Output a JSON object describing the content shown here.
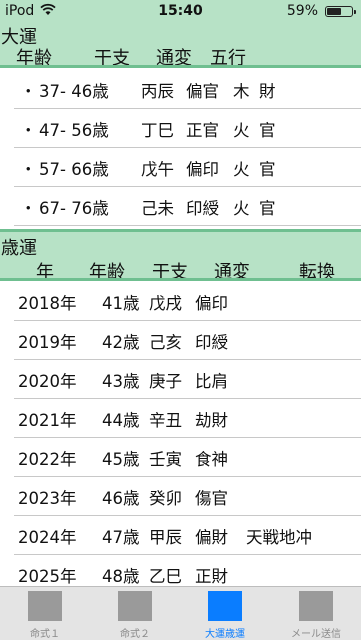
{
  "status_bar": {
    "carrier": "iPod",
    "time": "15:40",
    "battery": "59%",
    "battery_level": 0.59
  },
  "taiun": {
    "title": "大運",
    "headers": [
      "年齢",
      "干支",
      "通変",
      "五行"
    ],
    "rows": [
      {
        "bullet": "・",
        "age": "37- 46歳",
        "kanshi": "丙辰",
        "tsuhen": "偏官",
        "gogyo": "木",
        "kind": "財"
      },
      {
        "bullet": "・",
        "age": "47- 56歳",
        "kanshi": "丁巳",
        "tsuhen": "正官",
        "gogyo": "火",
        "kind": "官"
      },
      {
        "bullet": "・",
        "age": "57- 66歳",
        "kanshi": "戊午",
        "tsuhen": "偏印",
        "gogyo": "火",
        "kind": "官"
      },
      {
        "bullet": "・",
        "age": "67- 76歳",
        "kanshi": "己未",
        "tsuhen": "印綬",
        "gogyo": "火",
        "kind": "官"
      }
    ]
  },
  "saiun": {
    "title": "歳運",
    "headers": [
      "年",
      "年齢",
      "干支",
      "通変",
      "転換"
    ],
    "rows": [
      {
        "year": "2018年",
        "age": "41歳",
        "kanshi": "戊戌",
        "tsuhen": "偏印",
        "tenkan": ""
      },
      {
        "year": "2019年",
        "age": "42歳",
        "kanshi": "己亥",
        "tsuhen": "印綬",
        "tenkan": ""
      },
      {
        "year": "2020年",
        "age": "43歳",
        "kanshi": "庚子",
        "tsuhen": "比肩",
        "tenkan": ""
      },
      {
        "year": "2021年",
        "age": "44歳",
        "kanshi": "辛丑",
        "tsuhen": "劫財",
        "tenkan": ""
      },
      {
        "year": "2022年",
        "age": "45歳",
        "kanshi": "壬寅",
        "tsuhen": "食神",
        "tenkan": ""
      },
      {
        "year": "2023年",
        "age": "46歳",
        "kanshi": "癸卯",
        "tsuhen": "傷官",
        "tenkan": ""
      },
      {
        "year": "2024年",
        "age": "47歳",
        "kanshi": "甲辰",
        "tsuhen": "偏財",
        "tenkan": "天戦地冲"
      },
      {
        "year": "2025年",
        "age": "48歳",
        "kanshi": "乙巳",
        "tsuhen": "正財",
        "tenkan": ""
      }
    ]
  },
  "tabs": [
    {
      "label": "命式１",
      "icon": "square-icon",
      "active": false
    },
    {
      "label": "命式２",
      "icon": "square-icon",
      "active": false
    },
    {
      "label": "大運歳運",
      "icon": "square-icon",
      "active": true
    },
    {
      "label": "メール送信",
      "icon": "square-icon",
      "active": false
    }
  ],
  "colors": {
    "header_bg": "#b7e2c6",
    "header_rule": "#6fbf90",
    "accent": "#0a7dff"
  }
}
